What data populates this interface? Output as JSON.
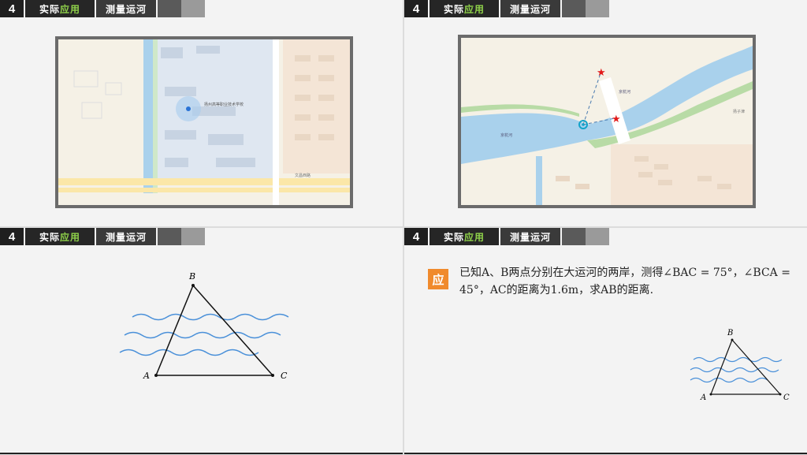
{
  "header": {
    "number": "4",
    "title_part1": "实际",
    "title_highlight": "应用",
    "subtitle": "测量运河"
  },
  "map1": {
    "school_label": "扬州高等职业技术学校",
    "road_label": "文昌西路"
  },
  "map2": {
    "river_label_left": "京杭河",
    "river_label_right": "京杭河",
    "area_label": "扬子津"
  },
  "diagram": {
    "label_a": "A",
    "label_b": "B",
    "label_c": "C"
  },
  "problem": {
    "badge": "应",
    "text": "已知A、B两点分别在大运河的两岸，测得∠BAC = 75°，∠BCA = 45°，AC的距离为1.6m，求AB的距离."
  },
  "colors": {
    "accent": "#8fd14a",
    "badge": "#f08a2c",
    "water": "#4a90d9"
  }
}
